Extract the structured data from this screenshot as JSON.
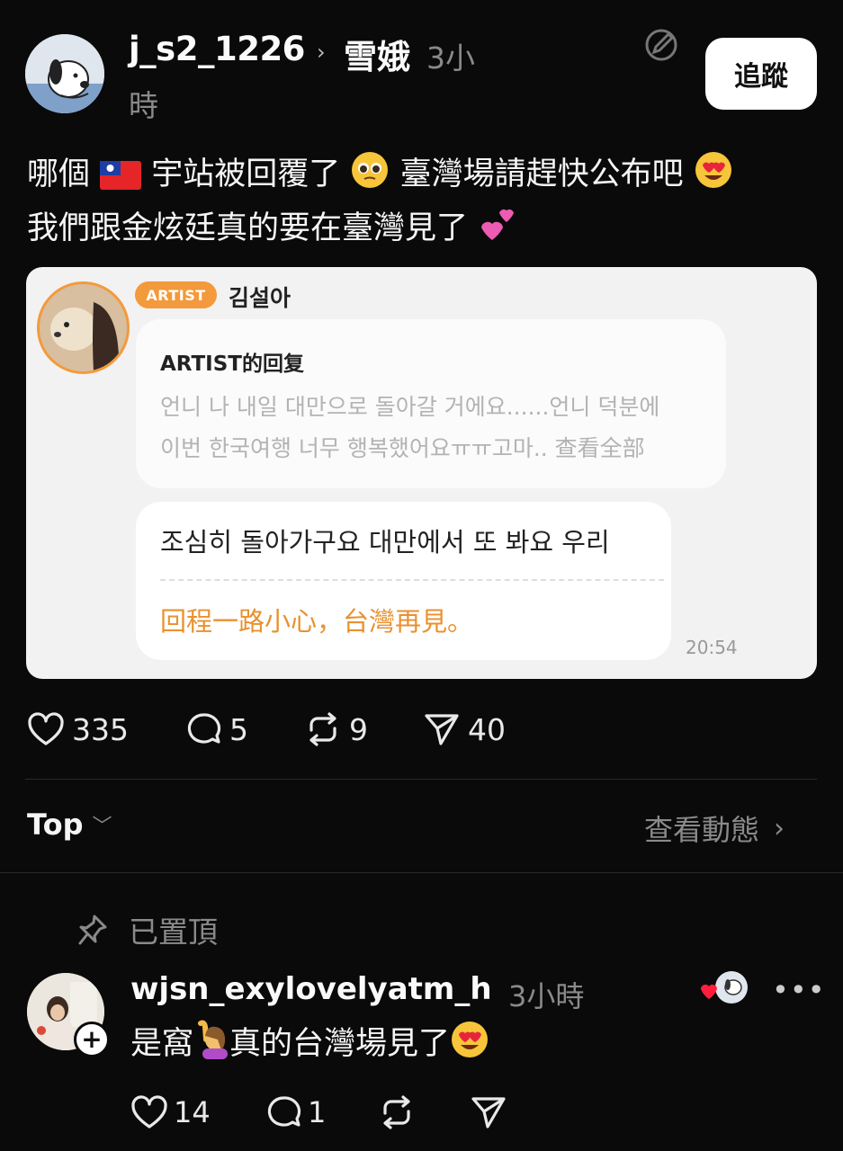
{
  "post": {
    "username": "j_s2_1226",
    "community": "雪娥",
    "time_part1": "3小",
    "time_part2": "時",
    "follow_label": "追蹤",
    "text_line1_a": "哪個",
    "text_line1_b": "宇站被回覆了",
    "text_line1_c": "臺灣場請趕快公布吧",
    "text_line2": "我們跟金炫廷真的要在臺灣見了"
  },
  "artist_card": {
    "badge": "ARTIST",
    "name": "김설아",
    "reply_title": "ARTIST的回复",
    "quoted_line1": "언니 나 내일 대만으로 돌아갈 거에요......언니 덕분에",
    "quoted_line2": "이번 한국여행 너무 행복했어요ㅠㅠ고마.. 查看全部",
    "reply_text": "조심히 돌아가구요 대만에서 또 봐요 우리",
    "translation": "回程一路小心，台灣再見。",
    "time": "20:54"
  },
  "stats": {
    "likes": "335",
    "comments": "5",
    "reposts": "9",
    "shares": "40"
  },
  "sort": {
    "label": "Top",
    "activity_label": "查看動態"
  },
  "pinned": {
    "label": "已置頂"
  },
  "reply": {
    "username": "wjsn_exylovelyatm_h",
    "time": "3小時",
    "text_a": "是窩",
    "text_b": "真的台灣場見了",
    "likes": "14",
    "comments": "1",
    "more": "•••"
  },
  "colors": {
    "background": "#0a0a0a",
    "accent_orange": "#f39a3c",
    "muted_text": "#8a8a8a"
  }
}
